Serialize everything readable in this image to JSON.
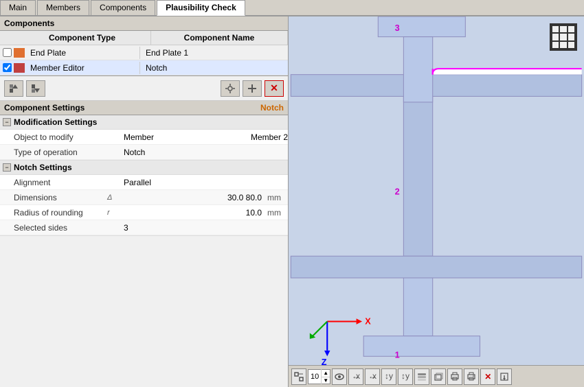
{
  "tabs": [
    {
      "label": "Main",
      "active": false
    },
    {
      "label": "Members",
      "active": false
    },
    {
      "label": "Components",
      "active": false
    },
    {
      "label": "Plausibility Check",
      "active": true
    }
  ],
  "components": {
    "title": "Components",
    "column_type": "Component Type",
    "column_name": "Component Name",
    "rows": [
      {
        "checked": false,
        "color": "#e07030",
        "type": "End Plate",
        "name": "End Plate 1"
      },
      {
        "checked": true,
        "color": "#c04040",
        "type": "Member Editor",
        "name": "Notch"
      }
    ]
  },
  "toolbar": {
    "buttons": [
      "←",
      "→",
      "⚙",
      "⚙",
      "✕"
    ]
  },
  "settings": {
    "header_label": "Component Settings",
    "header_name": "Notch",
    "modification": {
      "title": "Modification Settings",
      "rows": [
        {
          "key": "Object to modify",
          "delta": "",
          "value": "Member",
          "extra": "Member 2",
          "unit": ""
        },
        {
          "key": "Type of operation",
          "delta": "",
          "value": "Notch",
          "extra": "",
          "unit": ""
        }
      ]
    },
    "notch": {
      "title": "Notch Settings",
      "rows": [
        {
          "key": "Alignment",
          "delta": "",
          "value": "Parallel",
          "extra": "",
          "unit": ""
        },
        {
          "key": "Dimensions",
          "delta": "Δ",
          "value": "30.0 80.0",
          "extra": "",
          "unit": "mm"
        },
        {
          "key": "Radius of rounding",
          "delta": "r",
          "value": "10.0",
          "extra": "",
          "unit": "mm"
        },
        {
          "key": "Selected sides",
          "delta": "",
          "value": "3",
          "extra": "",
          "unit": ""
        }
      ]
    }
  },
  "view": {
    "number_labels": [
      "1",
      "2",
      "3"
    ],
    "axis": {
      "x_label": "X",
      "z_label": "Z"
    },
    "zoom_value": "10"
  },
  "view_toolbar_buttons": [
    "⬜",
    "10",
    "👁",
    "↔",
    "↔",
    "↕",
    "↕",
    "⬜",
    "⬜",
    "🖨",
    "🖨",
    "✕",
    "⬜"
  ]
}
